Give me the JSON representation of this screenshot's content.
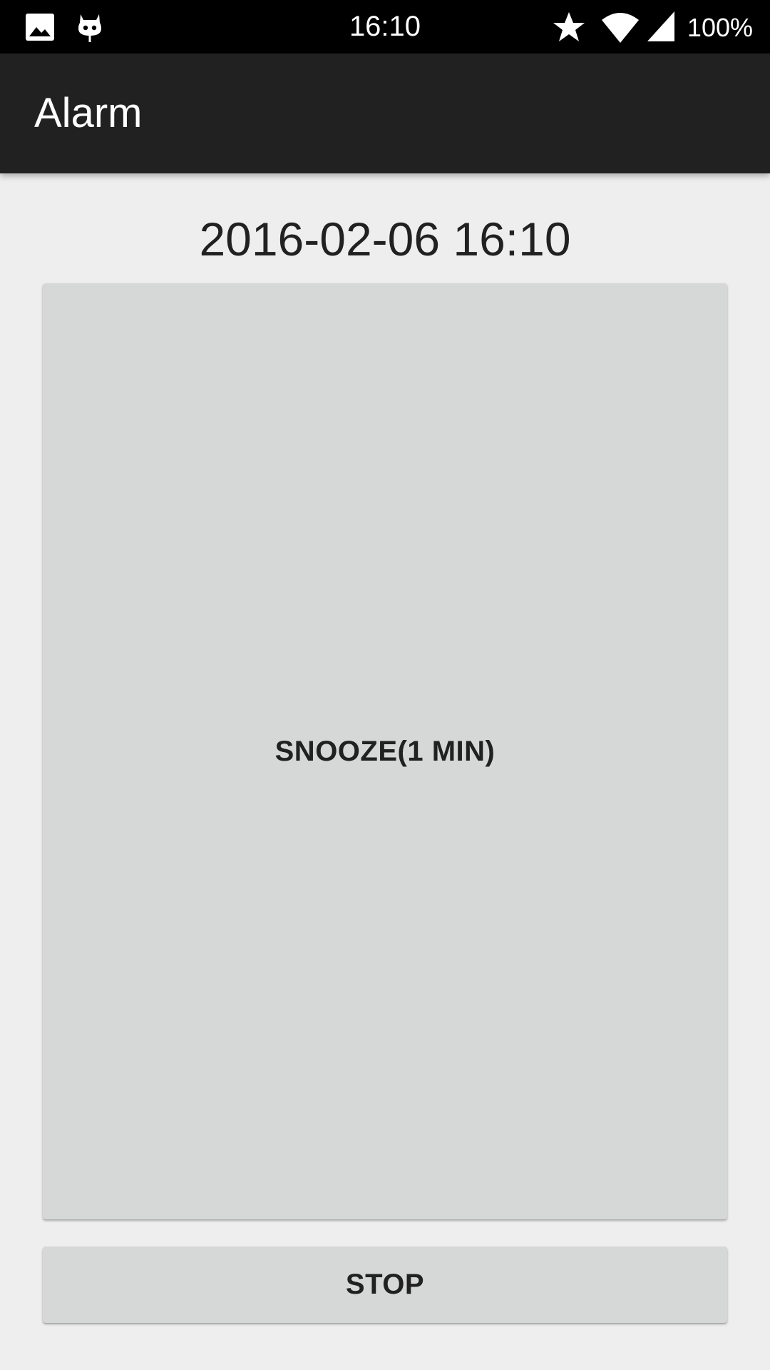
{
  "status_bar": {
    "time": "16:10",
    "battery": "100%",
    "icons": [
      "image-icon",
      "cyanogen-mascot-icon",
      "star-icon",
      "wifi-icon",
      "cell-signal-icon"
    ]
  },
  "app_bar": {
    "title": "Alarm"
  },
  "alarm": {
    "datetime": "2016-02-06 16:10",
    "snooze_label": "SNOOZE(1 MIN)",
    "stop_label": "STOP"
  },
  "colors": {
    "status_bar_bg": "#000000",
    "app_bar_bg": "#212121",
    "page_bg": "#eeeeee",
    "button_bg": "#d6d7d7",
    "text_dark": "#212121"
  }
}
